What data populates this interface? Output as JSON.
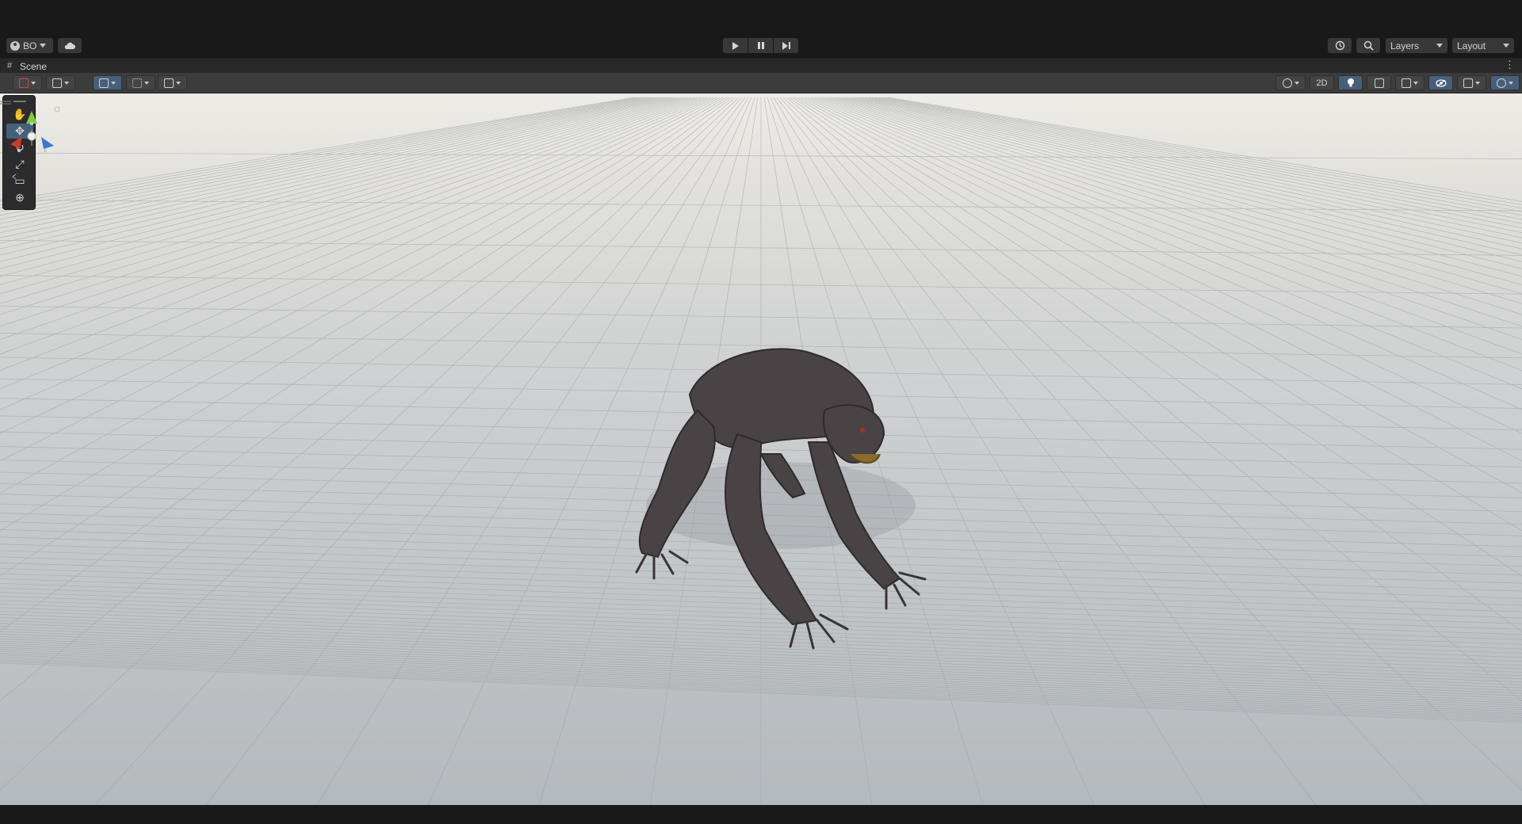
{
  "toolbar": {
    "account_label": "BO",
    "layers_label": "Layers",
    "layout_label": "Layout",
    "icons": [
      "account-icon",
      "cloud-icon",
      "play-icon",
      "pause-icon",
      "step-icon",
      "history-icon",
      "search-icon"
    ]
  },
  "scene_tab": {
    "label": "Scene",
    "icons": [
      "hash-icon",
      "more-options-icon"
    ]
  },
  "scene_toolbar": {
    "mode_2d_label": "2D",
    "left_icons": [
      "draw-mode-icon",
      "render-mode-icon",
      "grid-snap-icon",
      "increment-snap-icon",
      "scene-grid-icon"
    ],
    "right_icons": [
      "shading-mode-icon",
      "lighting-icon",
      "audio-icon",
      "effects-icon",
      "visibility-icon",
      "camera-icon",
      "gizmos-icon"
    ]
  },
  "tools": [
    "hand-tool-icon",
    "move-tool-icon",
    "rotate-tool-icon",
    "scale-tool-icon",
    "rect-tool-icon",
    "transform-tool-icon"
  ],
  "active_tool": "move-tool-icon",
  "colors": {
    "editor_bg": "#191919",
    "toolbar_bg": "#3c3c3c",
    "active_blue": "#46607c",
    "axis_x": "#d03a2e",
    "axis_y": "#7bd03b",
    "axis_z": "#3a77d8"
  }
}
